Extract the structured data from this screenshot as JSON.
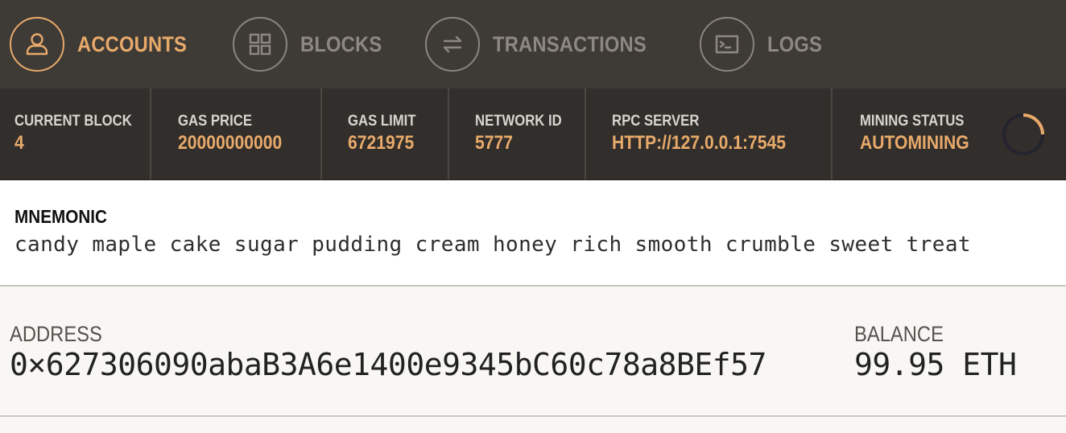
{
  "nav": {
    "items": [
      {
        "label": "ACCOUNTS",
        "icon": "user-icon",
        "active": true
      },
      {
        "label": "BLOCKS",
        "icon": "blocks-grid-icon",
        "active": false
      },
      {
        "label": "TRANSACTIONS",
        "icon": "arrows-swap-icon",
        "active": false
      },
      {
        "label": "LOGS",
        "icon": "terminal-icon",
        "active": false
      }
    ]
  },
  "stats": {
    "current_block": {
      "label": "CURRENT BLOCK",
      "value": "4"
    },
    "gas_price": {
      "label": "GAS PRICE",
      "value": "20000000000"
    },
    "gas_limit": {
      "label": "GAS LIMIT",
      "value": "6721975"
    },
    "network_id": {
      "label": "NETWORK ID",
      "value": "5777"
    },
    "rpc_server": {
      "label": "RPC SERVER",
      "value": "HTTP://127.0.0.1:7545"
    },
    "mining_status": {
      "label": "MINING STATUS",
      "value": "AUTOMINING"
    }
  },
  "mnemonic": {
    "label": "MNEMONIC",
    "words": "candy maple cake sugar pudding cream honey rich smooth crumble sweet treat"
  },
  "account": {
    "address_label": "ADDRESS",
    "address": "0×627306090abaB3A6e1400e9345bC60c78a8BEf57",
    "balance_label": "BALANCE",
    "balance": "99.95 ETH"
  },
  "colors": {
    "accent": "#e8aa6a",
    "nav_bg": "#3e3a36",
    "stats_bg": "#322e2b",
    "inactive": "#8d8883"
  }
}
